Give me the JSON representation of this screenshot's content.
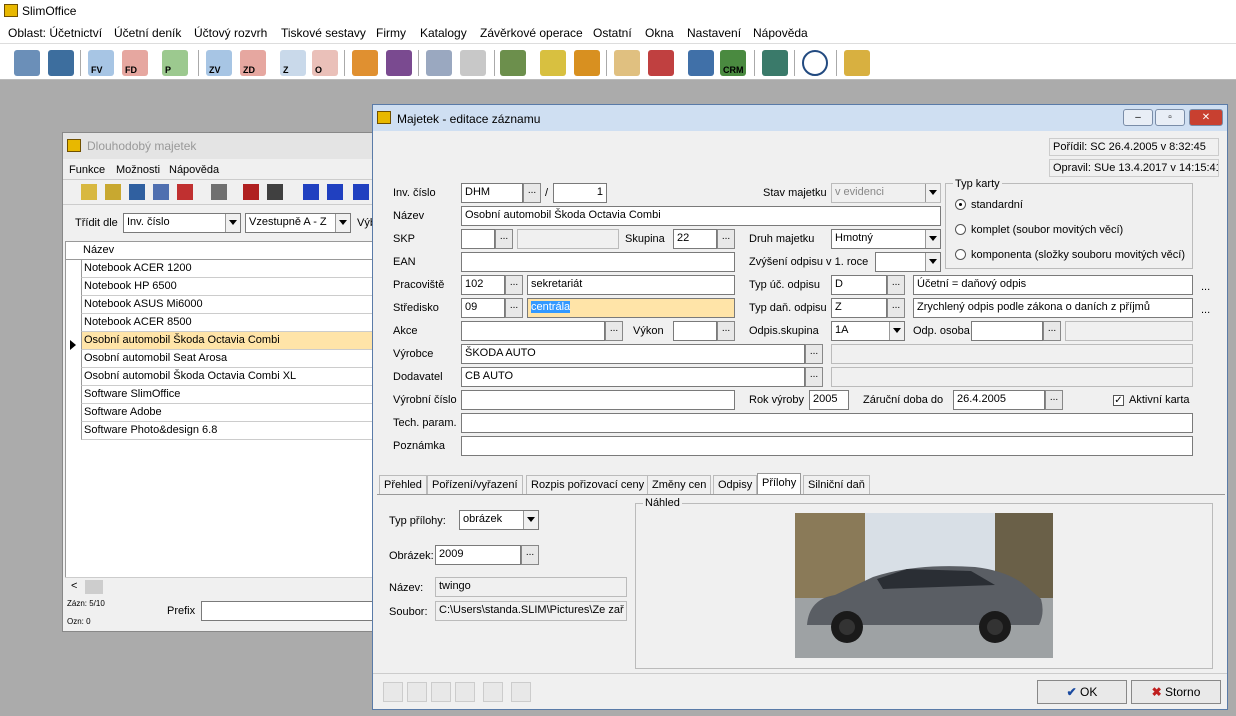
{
  "app": {
    "title": "SlimOffice"
  },
  "menubar": {
    "items": [
      "Oblast: Účetnictví",
      "Účetní deník",
      "Účtový rozvrh",
      "Tiskové sestavy",
      "Firmy",
      "Katalogy",
      "Závěrkové operace",
      "Ostatní",
      "Okna",
      "Nastavení",
      "Nápověda"
    ]
  },
  "toolbar": {
    "labels": [
      "FV",
      "FD",
      "P",
      "ZV",
      "ZD",
      "Z",
      "O",
      "CRM"
    ]
  },
  "left_window": {
    "title": "Dlouhodobý majetek",
    "menu": [
      "Funkce",
      "Možnosti",
      "Nápověda"
    ],
    "sort_label": "Třídit dle",
    "sort_field": "Inv. číslo",
    "sort_dir": "Vzestupně  A - Z",
    "cut_label": "Výb",
    "column_header": "Název",
    "rows": [
      "Notebook ACER 1200",
      "Notebook HP 6500",
      "Notebook ASUS Mi6000",
      "Notebook ACER 8500",
      "Osobní automobil Škoda Octavia Combi",
      "Osobní automobil Seat Arosa",
      "Osobní automobil Škoda Octavia Combi XL",
      "Software SlimOffice",
      "Software Adobe",
      "Software Photo&design 6.8"
    ],
    "selected_index": 4,
    "status_records": "Zázn: 5/10",
    "status_marked": "Ozn: 0",
    "prefix_label": "Prefix"
  },
  "dialog": {
    "title": "Majetek - editace záznamu",
    "acquired": "Pořídil: SC 26.4.2005 v 8:32:45",
    "modified": "Opravil: SUe 13.4.2017 v 14:15:41",
    "labels": {
      "inv": "Inv. číslo",
      "name": "Název",
      "skp": "SKP",
      "ean": "EAN",
      "workplace": "Pracoviště",
      "center": "Středisko",
      "action": "Akce",
      "maker": "Výrobce",
      "supplier": "Dodavatel",
      "serial": "Výrobní číslo",
      "tech": "Tech. param.",
      "note": "Poznámka",
      "state": "Stav majetku",
      "group": "Skupina",
      "kind": "Druh majetku",
      "increase": "Zvýšení odpisu v 1. roce",
      "acc_dep": "Typ úč. odpisu",
      "tax_dep": "Typ daň. odpisu",
      "power": "Výkon",
      "dep_group": "Odpis.skupina",
      "resp": "Odp. osoba",
      "year": "Rok výroby",
      "warranty": "Záruční doba do",
      "active": "Aktivní karta",
      "card_type": "Typ karty"
    },
    "values": {
      "inv_prefix": "DHM",
      "inv_sep": "/",
      "inv_num": "1",
      "name": "Osobní automobil Škoda Octavia Combi",
      "group": "22",
      "state": "v evidenci",
      "kind": "Hmotný",
      "workplace_code": "102",
      "workplace_name": "sekretariát",
      "center_code": "09",
      "center_name": "centrála",
      "acc_dep_code": "D",
      "acc_dep_name": "Účetní = daňový odpis",
      "tax_dep_code": "Z",
      "tax_dep_name": "Zrychlený odpis podle zákona o daních z příjmů",
      "dep_group": "1A",
      "maker": "ŠKODA AUTO",
      "supplier": "CB AUTO",
      "year": "2005",
      "warranty": "26.4.2005"
    },
    "card_types": [
      "standardní",
      "komplet (soubor movitých věcí)",
      "komponenta (složky souboru movitých věcí)"
    ],
    "tabs": [
      "Přehled",
      "Pořízení/vyřazení",
      "Rozpis pořizovací ceny",
      "Změny cen",
      "Odpisy",
      "Přílohy",
      "Silniční daň"
    ],
    "active_tab": 5,
    "attach": {
      "type_label": "Typ přílohy:",
      "type_value": "obrázek",
      "image_label": "Obrázek:",
      "image_value": "2009",
      "name_label": "Název:",
      "name_value": "twingo",
      "file_label": "Soubor:",
      "file_value": "C:\\Users\\standa.SLIM\\Pictures\\Ze zař",
      "preview_label": "Náhled"
    },
    "ok": "OK",
    "cancel": "Storno"
  }
}
